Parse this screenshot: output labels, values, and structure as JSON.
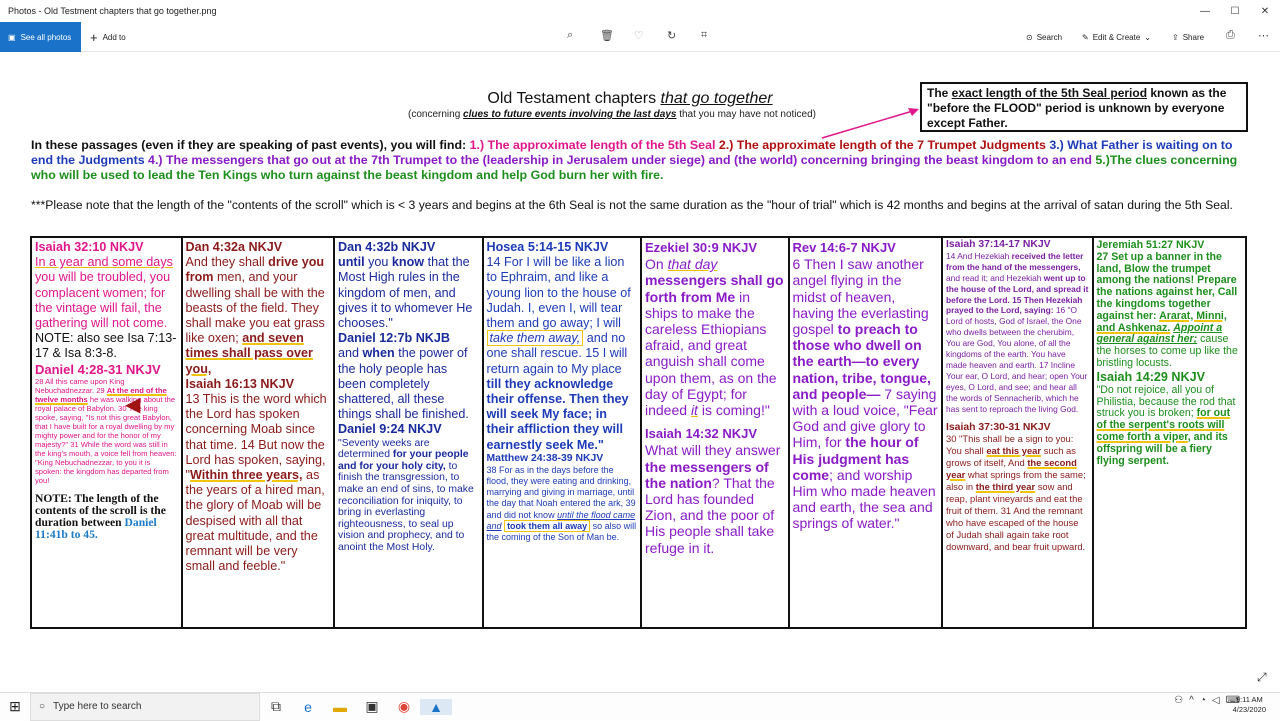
{
  "window": {
    "title": "Photos - Old Testment chapters that go together.png",
    "min": "—",
    "max": "☐",
    "close": "✕"
  },
  "toolbar": {
    "see_all_icon": "photos-icon",
    "see_all": "See all photos",
    "add_to": "Add to",
    "search": "Search",
    "edit_create": "Edit & Create",
    "share": "Share"
  },
  "doc": {
    "title_plain": "Old Testament chapters ",
    "title_italic": "that go together",
    "subtitle_pre": "(concerning ",
    "subtitle_bold": "clues to future events involving the last days",
    "subtitle_post": " that you may have not noticed)",
    "seal_pre": "The ",
    "seal_ul": "exact length of the 5th Seal period",
    "seal_post": " known as the \"before the FLOOD\" period is unknown by everyone except Father.",
    "intro_a": "In these passages (even if they are speaking of past events), you will find: ",
    "intro_b": "1.) The approximate length of the 5th Seal ",
    "intro_c": "2.) The approximate length of the 7 Trumpet Judgments ",
    "intro_d": "3.) What Father is waiting on to end the Judgments ",
    "intro_e": "4.) The messengers that go out at the 7th Trumpet to the (leadership in Jerusalem under siege) and (the world) concerning bringing the beast kingdom to an end ",
    "intro_f": "5.)The clues concerning who will be used to lead the Ten Kings who turn against the beast kingdom and help God burn her with fire.",
    "note": "***Please note that the length of the \"contents of the scroll\" which is < 3 years and begins at the 6th Seal is not the same duration as the \"hour of trial\" which is 42 months and begins at the arrival of satan during the 5th Seal."
  },
  "cols": {
    "c1": {
      "h1": "Isaiah 32:10 NKJV",
      "t1a": "In a year and some days",
      "t1b": " you will be troubled, you complacent women; for the vintage will fail, the gathering will not come.",
      "t1c": "NOTE: also see Isa 7:13-17 & Isa 8:3-8.",
      "h2": "Daniel 4:28-31 NKJV",
      "t2a": "28 All this came upon King Nebuchadnezzar. 29 ",
      "t2b": "At the end of the twelve months",
      "t2c": " he was walking about the royal palace of Babylon. 30 The king spoke, saying, \"Is not this great Babylon, that I have built for a royal dwelling by my mighty power and for the honor of my majesty?\" 31 While the word was still in the king's mouth, a voice fell from heaven: \"King Nebuchadnezzar, to you it is spoken: the kingdom has departed from you!",
      "note_a": "NOTE: The length of the contents of the scroll is the duration between ",
      "note_b": "Daniel 11:41b to 45."
    },
    "c2": {
      "h1": "Dan 4:32a NKJV",
      "t1a": "And they shall ",
      "t1b": "drive you from",
      "t1c": " men, and your dwelling shall be with the beasts of the field. They shall make you eat grass like oxen; ",
      "t1d": "and seven times shall pass over you,",
      "h2": "Isaiah 16:13 NKJV",
      "t2a": "13 This is the word which the Lord has spoken concerning Moab since that time. 14 But now the Lord has spoken, saying, \"",
      "t2b": "Within three years,",
      "t2c": " as the years of a hired man, the glory of Moab will be despised with all that great multitude, and the remnant will be very small and feeble.\""
    },
    "c3": {
      "h1": "Dan 4:32b NKJV",
      "t1a": "until",
      "t1b": " you ",
      "t1c": "know",
      "t1d": " that the Most High rules in the kingdom of men, and gives it to whomever He chooses.\"",
      "h2": "Daniel 12:7b NKJB",
      "t2a": "and ",
      "t2b": "when",
      "t2c": " the power of the holy people has been completely shattered, all these things shall be finished.",
      "h3": "Daniel 9:24 NKJV",
      "t3a": "\"Seventy weeks are determined ",
      "t3b": "for your people and for your holy city,",
      "t3c": " to finish the transgression, to make an end of sins, to make reconciliation for iniquity, to bring in everlasting righteousness, to seal up vision and prophecy, and to anoint the Most Holy."
    },
    "c4": {
      "h1": "Hosea 5:14-15 NKJV",
      "t1a": "14 For I will be like a lion to Ephraim, and like a young lion to the house of Judah. I, even I, will tear them and go away; I will ",
      "t1b": "take them away,",
      "t1c": " and no one shall rescue. 15 I will return again to My place ",
      "t1d": "till they acknowledge their offense. Then they will seek My face; in their affliction they will earnestly seek Me.\"",
      "h2": "Matthew 24:38-39 NKJV",
      "t2a": "38 For as in the days before the flood, they were eating and drinking, marrying and giving in marriage, until the day that Noah entered the ark, 39 and did not know ",
      "t2b": "until the flood came and",
      "t2c": "took them all away",
      "t2d": " so also will the coming of the Son of Man be."
    },
    "c5": {
      "h1": "Ezekiel 30:9 NKJV",
      "t1a": "On ",
      "t1b": "that day",
      "t1c": "messengers shall go forth from Me",
      "t1d": " in ships to make the careless Ethiopians afraid, and great anguish shall come upon them, as on the day of Egypt; for indeed ",
      "t1e": "it",
      "t1f": " is coming!\"",
      "h2": "Isaiah 14:32 NKJV",
      "t2a": "What will they answer ",
      "t2b": "the messengers of the nation",
      "t2c": "? That the Lord has founded Zion, and the poor of His people shall take refuge in it."
    },
    "c6": {
      "h1": "Rev 14:6-7 NKJV",
      "t1a": "6 Then I saw another angel flying in the midst of heaven, having the everlasting gospel ",
      "t1b": "to preach to those who dwell on the earth—to every nation, tribe, tongue, and people—",
      "t1c": " 7 saying with a loud voice, \"Fear God and give glory to Him, for ",
      "t1d": "the hour of His judgment has come",
      "t1e": "; and worship Him who made heaven and earth, the sea and springs of water.\""
    },
    "c7": {
      "h1": "Isaiah 37:14-17 NKJV",
      "t1a": "14 And Hezekiah ",
      "t1b": "received the letter from the hand of the messengers,",
      "t1c": " and read it; and Hezekiah ",
      "t1d": "went up to the house of the Lord, and spread it before the Lord. 15 Then Hezekiah prayed to the Lord, saying:",
      "t1e": " 16 \"O Lord of hosts, God of Israel, the One who dwells between the cherubim, You are God, You alone, of all the kingdoms of the earth. You have made heaven and earth. 17 Incline Your ear, O Lord, and hear; open Your eyes, O Lord, and see; and hear all the words of Sennacherib, which he has sent to reproach the living God.",
      "h2": "Isaiah 37:30-31 NKJV",
      "t2a": "30 \"This shall be a sign to you: You shall ",
      "t2b": "eat this year",
      "t2c": " such as grows of itself, And ",
      "t2d": "the second year",
      "t2e": " what springs from the same; also in ",
      "t2f": "the third year",
      "t2g": " sow and reap, plant vineyards and eat the fruit of them. 31 And the remnant who have escaped of the house of Judah shall again take root downward, and bear fruit upward."
    },
    "c8": {
      "h1": "Jeremiah 51:27 NKJV",
      "t1a": "27 Set up a banner in the land, Blow the trumpet among the nations! Prepare the nations against her, Call the kingdoms together against her: ",
      "t1b": "Ararat, Minni, and Ashkenaz.",
      "t1c": " ",
      "t1d": "Appoint a general against her;",
      "t1e": " cause the horses to come up like the bristling locusts.",
      "h2": "Isaiah 14:29 NKJV",
      "t2a": "\"Do not rejoice, all you of Philistia, because the rod that struck you is broken; ",
      "t2b": "for out of the serpent's roots will come forth a viper",
      "t2c": ", and its offspring will be a fiery flying serpent."
    }
  },
  "taskbar": {
    "search_placeholder": "Type here to search",
    "time": "9:11 AM",
    "date": "4/23/2020"
  }
}
